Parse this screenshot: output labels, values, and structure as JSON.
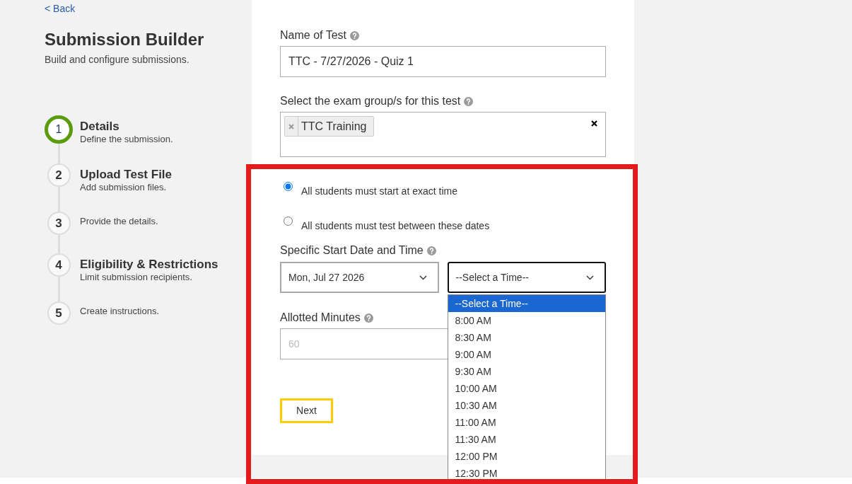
{
  "back_link": {
    "label": "< Back"
  },
  "header": {
    "title": "Submission Builder",
    "subtitle": "Build and configure submissions."
  },
  "steps": [
    {
      "number": "1",
      "title": "Details",
      "description": "Define the submission.",
      "current": true
    },
    {
      "number": "2",
      "title": "Upload Test File",
      "description": "Add submission files.",
      "current": false
    },
    {
      "number": "3",
      "description": "Provide the details.",
      "current": false
    },
    {
      "number": "4",
      "title": "Eligibility & Restrictions",
      "description": "Limit submission recipients.",
      "current": false
    },
    {
      "number": "5",
      "description": "Create instructions.",
      "current": false
    }
  ],
  "form": {
    "test_name": {
      "label": "Name of Test",
      "help": true,
      "value": "TTC - 7/27/2026 - Quiz 1"
    },
    "exam_groups": {
      "label": "Select the exam group/s for this test",
      "help": true,
      "tags": [
        "TTC Training"
      ]
    },
    "timing_options": [
      {
        "label": "All students must start at exact time",
        "selected": true
      },
      {
        "label": "All students must test between these dates",
        "selected": false
      }
    ],
    "start": {
      "label": "Specific Start Date and Time",
      "help": true,
      "date": "Mon, Jul 27 2026",
      "time": {
        "value": "--Select a Time--",
        "expanded": true,
        "options": [
          {
            "label": "--Select a Time--",
            "selected": true
          },
          {
            "label": "8:00 AM",
            "selected": false
          },
          {
            "label": "8:30 AM",
            "selected": false
          },
          {
            "label": "9:00 AM",
            "selected": false
          },
          {
            "label": "9:30 AM",
            "selected": false
          },
          {
            "label": "10:00 AM",
            "selected": false
          },
          {
            "label": "10:30 AM",
            "selected": false
          },
          {
            "label": "11:00 AM",
            "selected": false
          },
          {
            "label": "11:30 AM",
            "selected": false
          },
          {
            "label": "12:00 PM",
            "selected": false
          },
          {
            "label": "12:30 PM",
            "selected": false
          }
        ]
      }
    },
    "allotted_minutes": {
      "label": "Allotted Minutes",
      "help": true,
      "placeholder": "60"
    },
    "next_button": {
      "label": "Next"
    }
  },
  "annotation": {
    "kind": "highlight-frame"
  }
}
